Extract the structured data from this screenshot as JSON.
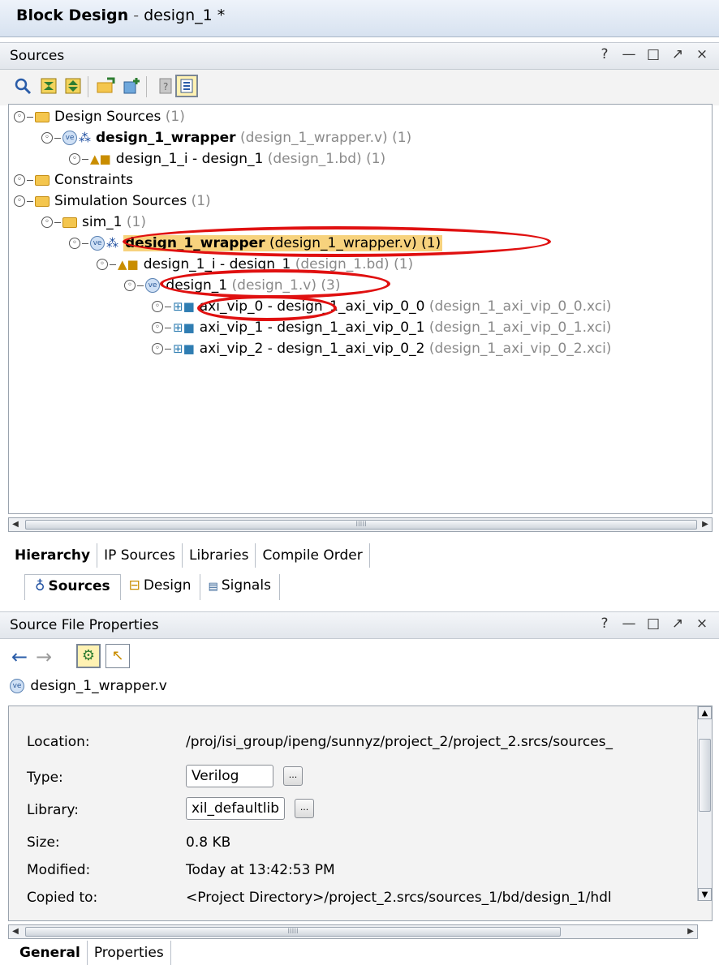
{
  "window": {
    "title_bold": "Block Design",
    "title_separator": " - ",
    "title_rest": "design_1 *"
  },
  "sources_panel": {
    "title": "Sources",
    "controls": [
      "?",
      "—",
      "□",
      "↗",
      "×"
    ],
    "toolbar_icons": [
      "search-icon",
      "collapse-all-icon",
      "expand-all-icon",
      "add-sources-icon",
      "add-ip-icon",
      "properties-icon",
      "show-hierarchy-icon"
    ]
  },
  "tree": {
    "design_sources": {
      "label": "Design Sources",
      "count": "(1)"
    },
    "wrapper1": {
      "name": "design_1_wrapper",
      "file": "(design_1_wrapper.v)",
      "count": "(1)"
    },
    "bd1": {
      "name": "design_1_i - design_1",
      "file": "(design_1.bd)",
      "count": "(1)"
    },
    "constraints": {
      "label": "Constraints"
    },
    "sim_sources": {
      "label": "Simulation Sources",
      "count": "(1)"
    },
    "sim_1": {
      "label": "sim_1",
      "count": "(1)"
    },
    "wrapper2": {
      "name": "design_1_wrapper",
      "file": "(design_1_wrapper.v)",
      "count": "(1)"
    },
    "bd2": {
      "name": "design_1_i - design_1",
      "file": "(design_1.bd)",
      "count": "(1)"
    },
    "design1v": {
      "name": "design_1",
      "file": "(design_1.v)",
      "count": "(3)"
    },
    "vip0": {
      "name": "axi_vip_0 - design_1_axi_vip_0_0",
      "file": "(design_1_axi_vip_0_0.xci)"
    },
    "vip1": {
      "name": "axi_vip_1 - design_1_axi_vip_0_1",
      "file": "(design_1_axi_vip_0_1.xci)"
    },
    "vip2": {
      "name": "axi_vip_2 - design_1_axi_vip_0_2",
      "file": "(design_1_axi_vip_0_2.xci)"
    }
  },
  "view_tabs": [
    "Hierarchy",
    "IP Sources",
    "Libraries",
    "Compile Order"
  ],
  "window_tabs": [
    "Sources",
    "Design",
    "Signals"
  ],
  "properties_panel": {
    "title": "Source File Properties",
    "controls": [
      "?",
      "—",
      "□",
      "↗",
      "×"
    ],
    "file_name": "design_1_wrapper.v",
    "fields": {
      "location_label": "Location:",
      "location_value": "/proj/isi_group/ipeng/sunnyz/project_2/project_2.srcs/sources_",
      "type_label": "Type:",
      "type_value": "Verilog",
      "library_label": "Library:",
      "library_value": "xil_defaultlib",
      "size_label": "Size:",
      "size_value": "0.8 KB",
      "modified_label": "Modified:",
      "modified_value": "Today at 13:42:53 PM",
      "copied_label": "Copied to:",
      "copied_value": "<Project Directory>/project_2.srcs/sources_1/bd/design_1/hdl"
    },
    "ellipsis": "...",
    "tabs": [
      "General",
      "Properties"
    ]
  },
  "scroll_grip": "IIIII",
  "highlight_color": "#e01010"
}
